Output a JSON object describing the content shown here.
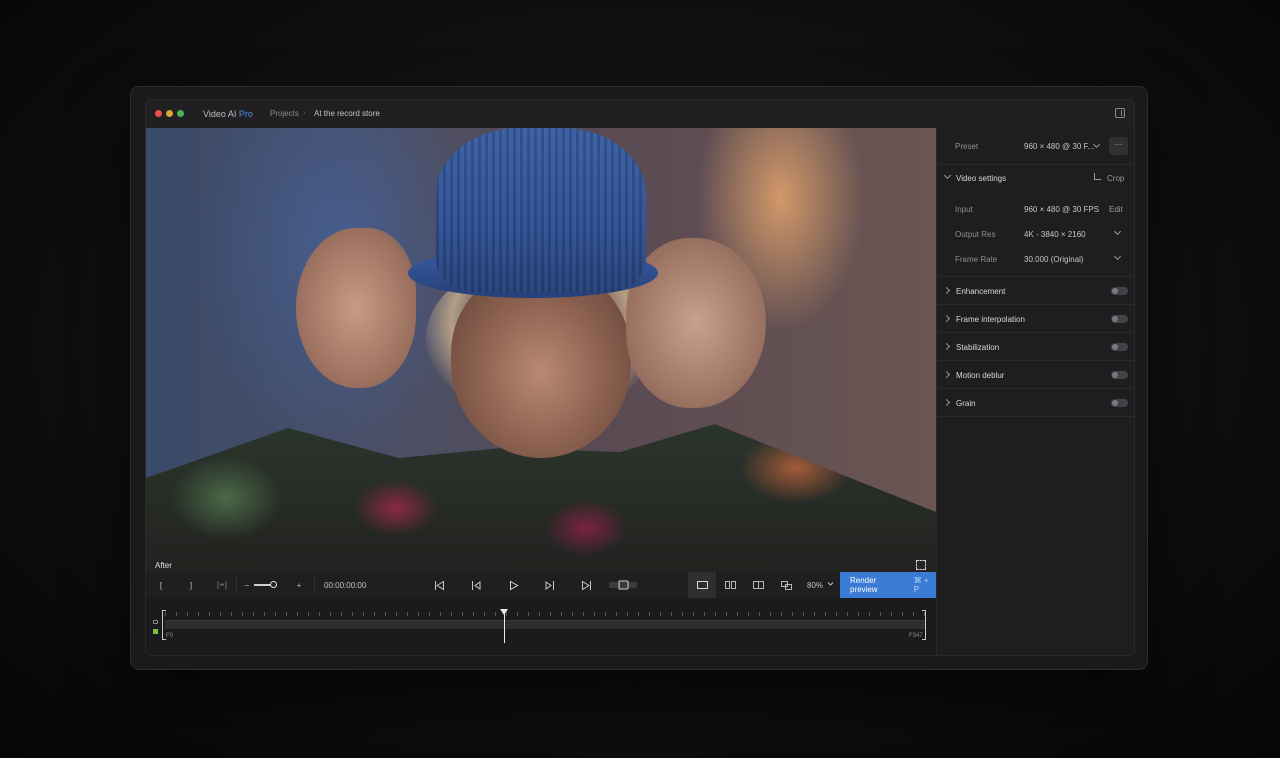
{
  "titlebar": {
    "app_name": "Video AI",
    "app_edition": "Pro",
    "breadcrumb_1": "Projects",
    "breadcrumb_sep": "›",
    "breadcrumb_2": "At the record store"
  },
  "viewer": {
    "label": "After"
  },
  "controls": {
    "in_bracket": "[",
    "out_bracket": "]",
    "minus": "−",
    "plus": "+",
    "timecode": "00:00:00:00",
    "zoom": "80%",
    "render_label": "Render preview",
    "render_shortcut": "⌘ + P"
  },
  "timeline": {
    "start_frame": "F0",
    "end_frame": "F347"
  },
  "panel": {
    "preset_label": "Preset",
    "preset_value": "960 × 480 @ 30 F...",
    "more_label": "···",
    "video_settings": "Video settings",
    "crop_label": "Crop",
    "input_label": "Input",
    "input_value": "960 × 480 @ 30 FPS",
    "edit_label": "Edit",
    "output_label": "Output Res",
    "output_value": "4K - 3840 × 2160",
    "framerate_label": "Frame Rate",
    "framerate_value": "30.000 (Original)",
    "sections": [
      {
        "label": "Enhancement"
      },
      {
        "label": "Frame interpolation"
      },
      {
        "label": "Stabilization"
      },
      {
        "label": "Motion deblur"
      },
      {
        "label": "Grain"
      }
    ]
  },
  "colors": {
    "accent": "#3a7bd5",
    "pro": "#4b8de0"
  }
}
